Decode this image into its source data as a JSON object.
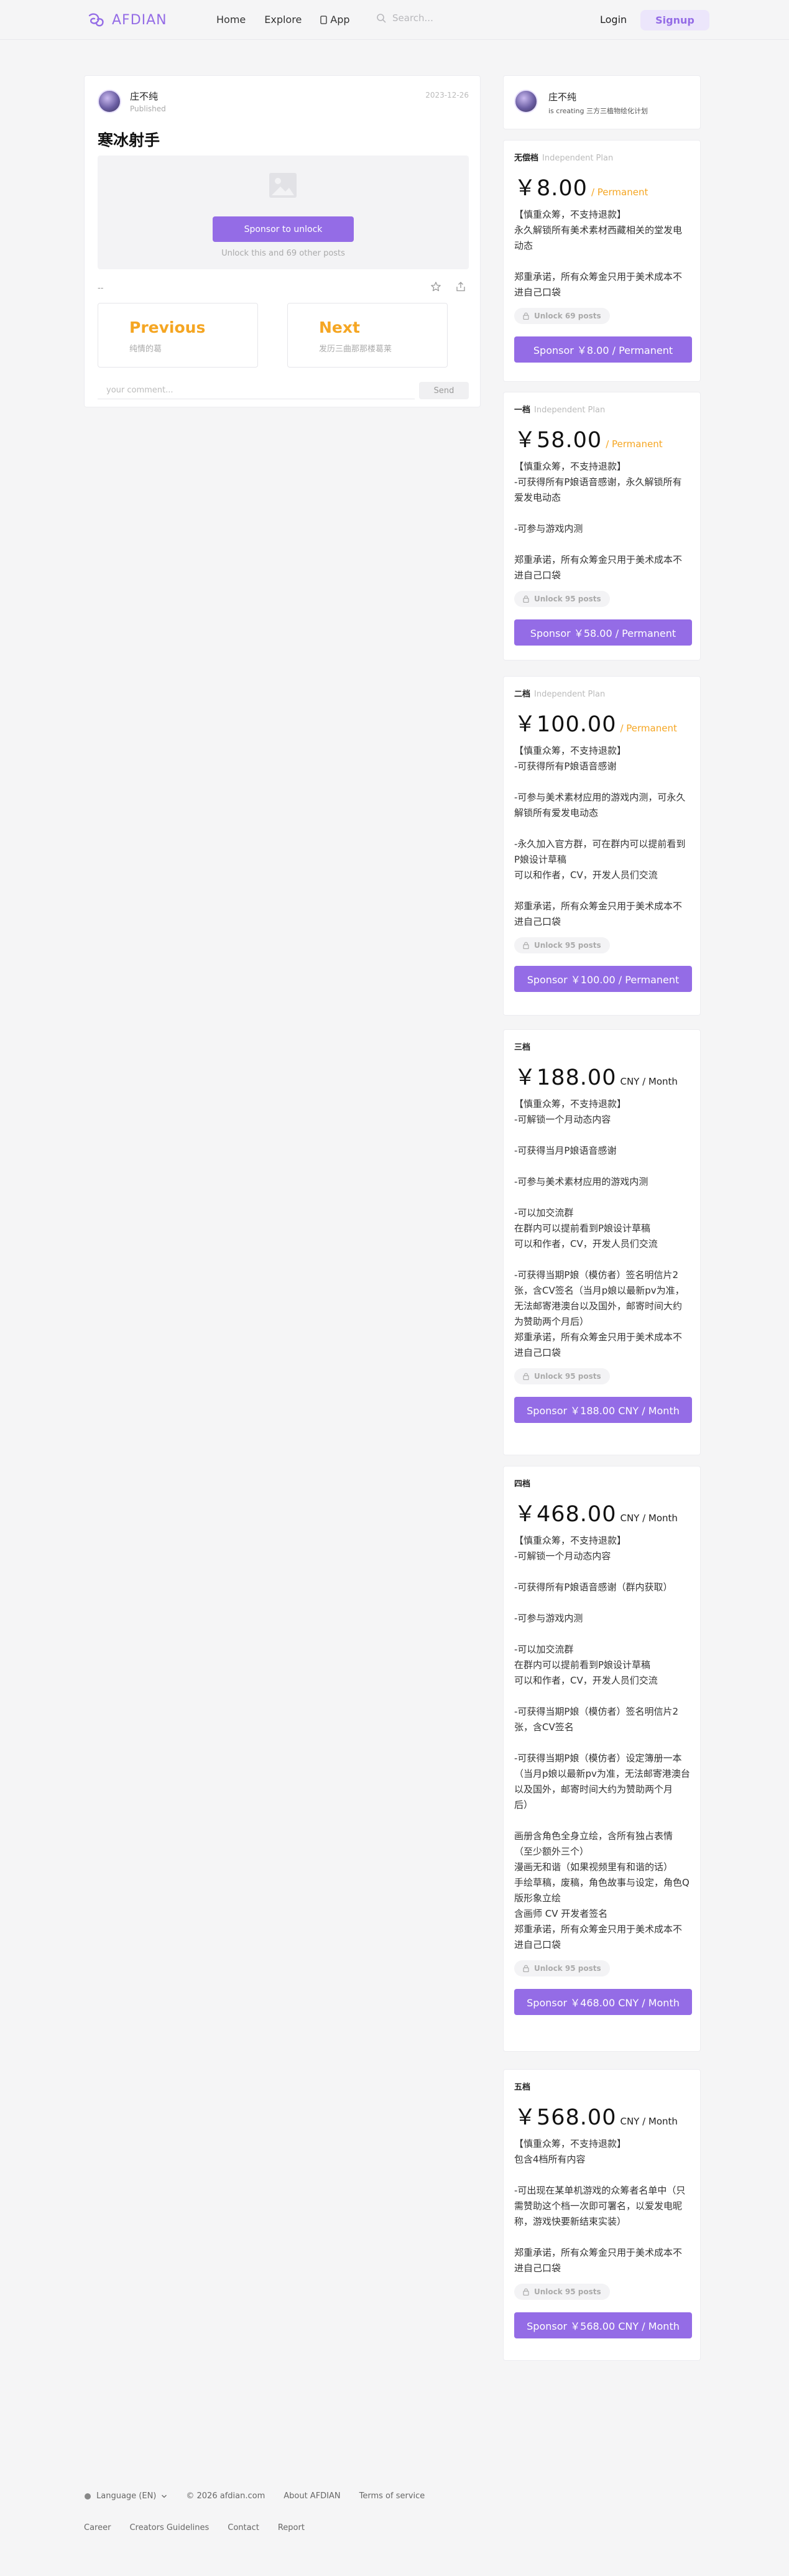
{
  "header": {
    "logo_text": "AFDIAN",
    "nav": {
      "home": "Home",
      "explore": "Explore",
      "app": "App"
    },
    "search_placeholder": "Search...",
    "login": "Login",
    "signup": "Signup"
  },
  "post": {
    "author": "庄不纯",
    "status": "Published",
    "date": "2023-12-26",
    "title": "寒冰射手",
    "unlock_button": "Sponsor to unlock",
    "unlock_note": "Unlock this and 69 other posts",
    "dash": "--",
    "prev_title": "Previous",
    "prev_sub": "纯情的葛",
    "next_title": "Next",
    "next_sub": "发历三曲那那楼葛莱",
    "comment_placeholder": "your comment...",
    "send": "Send"
  },
  "creator": {
    "name": "庄不纯",
    "subtitle": "is creating 三方三植物绘化计划"
  },
  "plans": [
    {
      "name": "无偿档",
      "type": "Independent Plan",
      "price": "￥8.00",
      "unit": "/ Permanent",
      "description": "【慎重众筹，不支持退款】\n永久解锁所有美术素材西藏相关的堂发电动态\n\n郑重承诺，所有众筹金只用于美术成本不进自己口袋",
      "unlock": "Unlock 69 posts",
      "button": "Sponsor ￥8.00 / Permanent"
    },
    {
      "name": "一档",
      "type": "Independent Plan",
      "price": "￥58.00",
      "unit": "/ Permanent",
      "description": "【慎重众筹，不支持退款】\n-可获得所有P娘语音感谢，永久解锁所有爱发电动态\n\n-可参与游戏内测\n\n郑重承诺，所有众筹金只用于美术成本不进自己口袋",
      "unlock": "Unlock 95 posts",
      "button": "Sponsor ￥58.00 / Permanent"
    },
    {
      "name": "二档",
      "type": "Independent Plan",
      "price": "￥100.00",
      "unit": "/ Permanent",
      "description": "【慎重众筹，不支持退款】\n-可获得所有P娘语音感谢\n\n-可参与美术素材应用的游戏内测，可永久解锁所有爱发电动态\n\n-永久加入官方群，可在群内可以提前看到P娘设计草稿\n可以和作者，CV，开发人员们交流\n\n郑重承诺，所有众筹金只用于美术成本不进自己口袋",
      "unlock": "Unlock 95 posts",
      "button": "Sponsor ￥100.00 / Permanent"
    },
    {
      "name": "三档",
      "type": "",
      "price": "￥188.00",
      "unit": "CNY / Month",
      "description": "【慎重众筹，不支持退款】\n-可解锁一个月动态内容\n\n-可获得当月P娘语音感谢\n\n-可参与美术素材应用的游戏内测\n\n-可以加交流群\n在群内可以提前看到P娘设计草稿\n可以和作者，CV，开发人员们交流\n\n-可获得当期P娘（模仿者）签名明信片2张，含CV签名（当月p娘以最新pv为准，无法邮寄港澳台以及国外，邮寄时间大约为赞助两个月后）\n郑重承诺，所有众筹金只用于美术成本不进自己口袋",
      "unlock": "Unlock 95 posts",
      "button": "Sponsor ￥188.00 CNY / Month"
    },
    {
      "name": "四档",
      "type": "",
      "price": "￥468.00",
      "unit": "CNY / Month",
      "description": "【慎重众筹，不支持退款】\n-可解锁一个月动态内容\n\n-可获得所有P娘语音感谢（群内获取）\n\n-可参与游戏内测\n\n-可以加交流群\n在群内可以提前看到P娘设计草稿\n可以和作者，CV，开发人员们交流\n\n-可获得当期P娘（模仿者）签名明信片2张，含CV签名\n\n-可获得当期P娘（模仿者）设定簿册一本（当月p娘以最新pv为准，无法邮寄港澳台以及国外，邮寄时间大约为赞助两个月后）\n\n画册含角色全身立绘，含所有独占表情（至少额外三个）\n漫画无和谐（如果视频里有和谐的话）\n手绘草稿，废稿，角色故事与设定，角色Q版形象立绘\n含画师 CV 开发者签名\n郑重承诺，所有众筹金只用于美术成本不进自己口袋",
      "unlock": "Unlock 95 posts",
      "button": "Sponsor ￥468.00 CNY / Month"
    },
    {
      "name": "五档",
      "type": "",
      "price": "￥568.00",
      "unit": "CNY / Month",
      "description": "【慎重众筹，不支持退款】\n包含4档所有内容\n\n-可出现在某单机游戏的众筹者名单中（只需赞助这个档一次即可署名，以爱发电昵称，游戏快要新结束实装）\n\n郑重承诺，所有众筹金只用于美术成本不进自己口袋",
      "unlock": "Unlock 95 posts",
      "button": "Sponsor ￥568.00 CNY / Month"
    }
  ],
  "footer": {
    "language": "Language (EN)",
    "copyright": "© 2026 afdian.com",
    "about": "About AFDIAN",
    "terms": "Terms of service",
    "career": "Career",
    "guidelines": "Creators Guidelines",
    "contact": "Contact",
    "report": "Report"
  },
  "colors": {
    "accent": "#946ce6",
    "orange": "#f5a623",
    "background": "#f5f5f6"
  }
}
